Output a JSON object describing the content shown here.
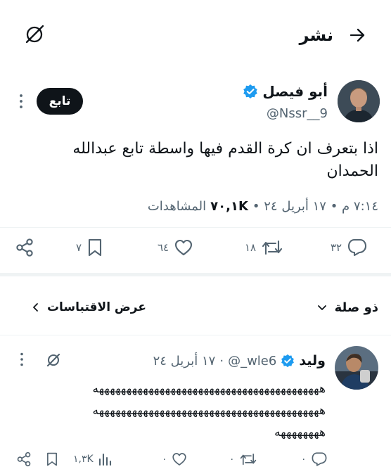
{
  "header": {
    "title": "نشر",
    "back_icon": "arrow-right-icon",
    "translate_icon": "translate-icon"
  },
  "post": {
    "author": {
      "name": "أبو فيصل",
      "handle": "@Nssr__9",
      "verified": true,
      "badge_color": "#1d9bf0"
    },
    "follow_label": "تابع",
    "text_line1": "اذا بتعرف ان كرة القدم فيها واسطة تابع عبدالله",
    "text_line2": "الحمدان",
    "meta": {
      "time_date": "٧:١٤ م • ١٧ أبريل ٢٤ •",
      "views_count": "٧٠,١K",
      "views_label": "المشاهدات"
    },
    "stats": {
      "replies": "٣٢",
      "reposts": "١٨",
      "likes": "٦٤",
      "bookmarks": "٧"
    }
  },
  "filter": {
    "sort_label": "ذو صلة",
    "quotes_label": "عرض الاقتباسات"
  },
  "reply": {
    "author": {
      "name": "وليد",
      "handle": "@_wle6",
      "verified": true,
      "date": "١٧ أبريل ٢٤",
      "separator": "·"
    },
    "text_line1": "هههههههههههههههههههههههههههههههههههههههههه",
    "text_line2": "هههههههههههههههههههههههههههههههههههههههههه",
    "text_line3": "ههههههههه",
    "stats": {
      "replies": "٠",
      "reposts": "٠",
      "likes": "٠",
      "views": "١,٣K"
    }
  },
  "colors": {
    "accent": "#1d9bf0",
    "text": "#0f1419",
    "muted": "#536471",
    "follow_bg": "#0f1419"
  }
}
